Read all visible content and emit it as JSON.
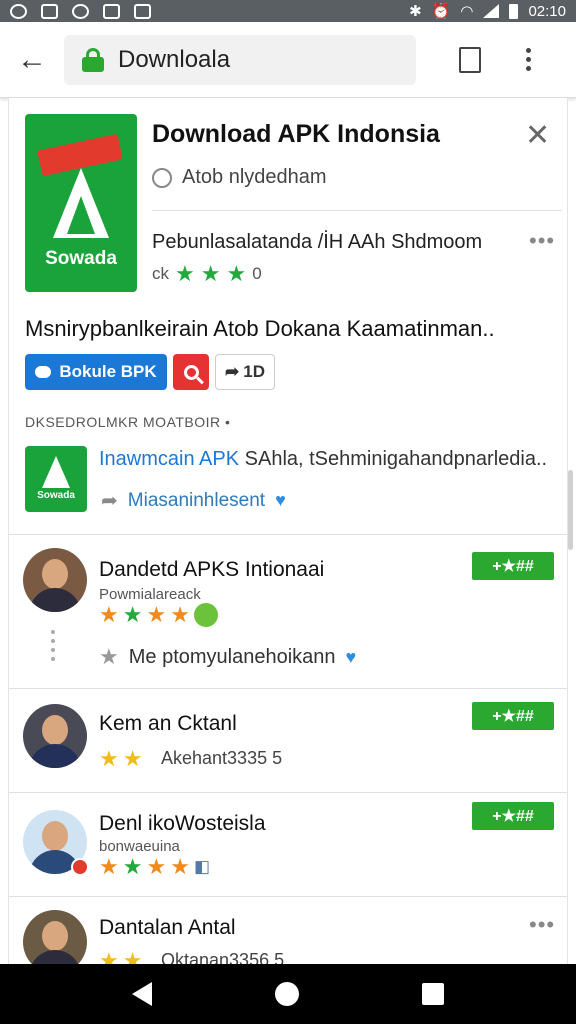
{
  "status_bar": {
    "time": "02:10"
  },
  "toolbar": {
    "url": "Downloala"
  },
  "app": {
    "title": "Download APK Indonsia",
    "publisher": "Atob nlydedham",
    "subtitle": "Pebunlasalatanda /İH AAh Shdmoom",
    "hero_word": "Sowada",
    "rating_extra": "0",
    "description": "Msnirypbanlkeirain Atob Dokana Kaamatinman..",
    "buttons": {
      "primary": "Bokule BPK",
      "secondary": "1D"
    }
  },
  "section": {
    "label": "DKSEDROLMKR MOATBOIR"
  },
  "sponsored": {
    "icon_word": "Sowada",
    "title_link": "Inawmcain APK",
    "title_rest": "SAhla, tSehminigahandpnarledia..",
    "sub": "Miasaninhlesent"
  },
  "reviews": [
    {
      "name": "Dandetd APKS Intionaai",
      "meta": "Powmialareack",
      "badge": "+★##",
      "stars": 4,
      "reply": "Me ptomyulanehoikann"
    },
    {
      "name": "Kem an Cktanl",
      "meta": "Akehant3335 5",
      "badge": "+★##",
      "stars": 2
    },
    {
      "name": "Denl ikoWosteisla",
      "meta": "bonwaeuina",
      "badge": "+★##",
      "stars": 4
    },
    {
      "name": "Dantalan Antal",
      "meta": "Oktanan3356 5",
      "badge": ""
    }
  ],
  "colors": {
    "accent_green": "#2aa830",
    "link_blue": "#1b78d6",
    "status_bar": "#5a5f63"
  },
  "icons": [
    "back-arrow-icon",
    "lock-icon",
    "bookmark-icon",
    "overflow-menu-icon",
    "close-icon",
    "clock-icon",
    "search-icon",
    "share-icon",
    "heart-icon",
    "star-icon"
  ]
}
